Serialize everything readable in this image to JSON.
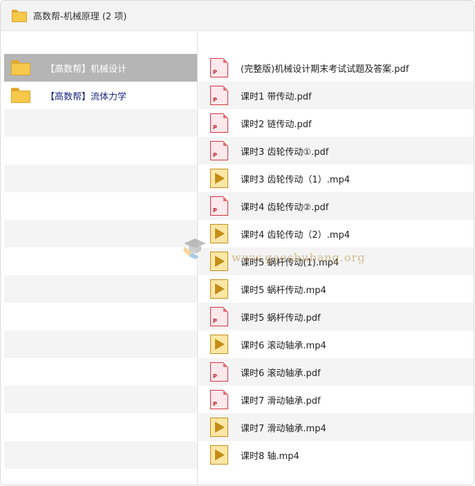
{
  "window": {
    "title": "高数帮-机械原理 (2 项)",
    "title_icon": "folder-icon"
  },
  "left_pane": {
    "items": [
      {
        "label": "【高数帮】机械设计",
        "icon": "folder-icon",
        "selected": true
      },
      {
        "label": "【高数帮】流体力学",
        "icon": "folder-icon",
        "selected": false
      }
    ]
  },
  "right_pane": {
    "files": [
      {
        "name": "(完整版)机械设计期末考试试题及答案.pdf",
        "type": "pdf",
        "icon_letter": "P"
      },
      {
        "name": "课时1 带传动.pdf",
        "type": "pdf",
        "icon_letter": "P"
      },
      {
        "name": "课时2 链传动.pdf",
        "type": "pdf",
        "icon_letter": "P"
      },
      {
        "name": "课时3 齿轮传动①.pdf",
        "type": "pdf",
        "icon_letter": "P"
      },
      {
        "name": "课时3 齿轮传动（1）.mp4",
        "type": "mp4"
      },
      {
        "name": "课时4 齿轮传动②.pdf",
        "type": "pdf",
        "icon_letter": "P"
      },
      {
        "name": "课时4 齿轮传动（2）.mp4",
        "type": "mp4"
      },
      {
        "name": "课时5 蜗杆传动(1).mp4",
        "type": "mp4"
      },
      {
        "name": "课时5 蜗杆传动.mp4",
        "type": "mp4"
      },
      {
        "name": "课时5 蜗杆传动.pdf",
        "type": "pdf",
        "icon_letter": "P"
      },
      {
        "name": "课时6 滚动轴承.mp4",
        "type": "mp4"
      },
      {
        "name": "课时6 滚动轴承.pdf",
        "type": "pdf",
        "icon_letter": "P"
      },
      {
        "name": "课时7  滑动轴承.pdf",
        "type": "pdf",
        "icon_letter": "P"
      },
      {
        "name": "课时7 滑动轴承.mp4",
        "type": "mp4"
      },
      {
        "name": "课时8 轴.mp4",
        "type": "mp4"
      }
    ]
  },
  "watermark": {
    "text": "www.gaoshubang.org",
    "icon": "graduation-cap-icon"
  },
  "colors": {
    "selected_row": "#b5b5b5",
    "alt_row": "#f4f4f4",
    "folder_yellow": "#f7c94b",
    "pdf_red": "#d0343f",
    "mp4_gold": "#c48d16",
    "link_text": "#1a237e"
  }
}
